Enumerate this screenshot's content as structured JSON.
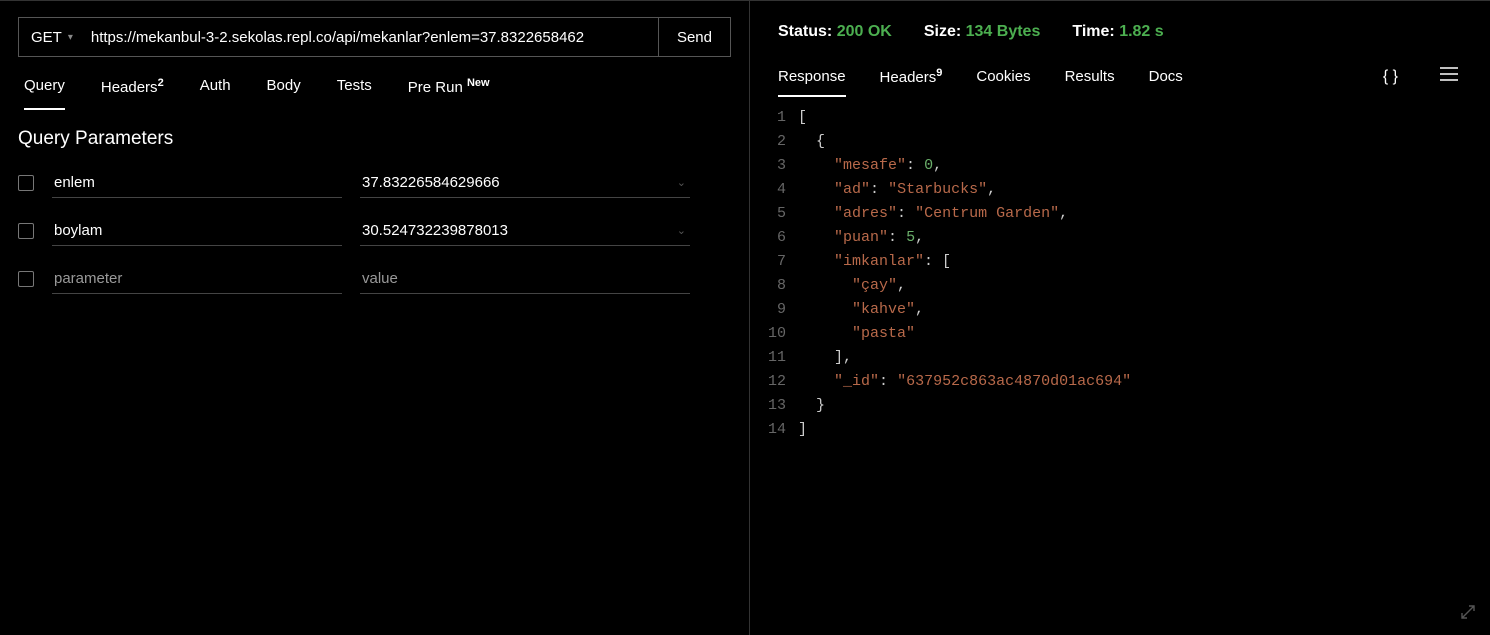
{
  "request": {
    "method": "GET",
    "url": "https://mekanbul-3-2.sekolas.repl.co/api/mekanlar?enlem=37.8322658462",
    "send_label": "Send"
  },
  "left_tabs": {
    "query": "Query",
    "headers": "Headers",
    "headers_count": "2",
    "auth": "Auth",
    "body": "Body",
    "tests": "Tests",
    "prerun": "Pre Run",
    "prerun_badge": "New"
  },
  "section_title": "Query Parameters",
  "params": [
    {
      "key": "enlem",
      "value": "37.83226584629666"
    },
    {
      "key": "boylam",
      "value": "30.524732239878013"
    },
    {
      "key": "",
      "value": ""
    }
  ],
  "param_placeholder_key": "parameter",
  "param_placeholder_value": "value",
  "status": {
    "status_label": "Status:",
    "status_value": "200 OK",
    "size_label": "Size:",
    "size_value": "134 Bytes",
    "time_label": "Time:",
    "time_value": "1.82 s"
  },
  "right_tabs": {
    "response": "Response",
    "headers": "Headers",
    "headers_count": "9",
    "cookies": "Cookies",
    "results": "Results",
    "docs": "Docs"
  },
  "response_json": [
    {
      "mesafe": 0,
      "ad": "Starbucks",
      "adres": "Centrum Garden",
      "puan": 5,
      "imkanlar": [
        "çay",
        "kahve",
        "pasta"
      ],
      "_id": "637952c863ac4870d01ac694"
    }
  ]
}
